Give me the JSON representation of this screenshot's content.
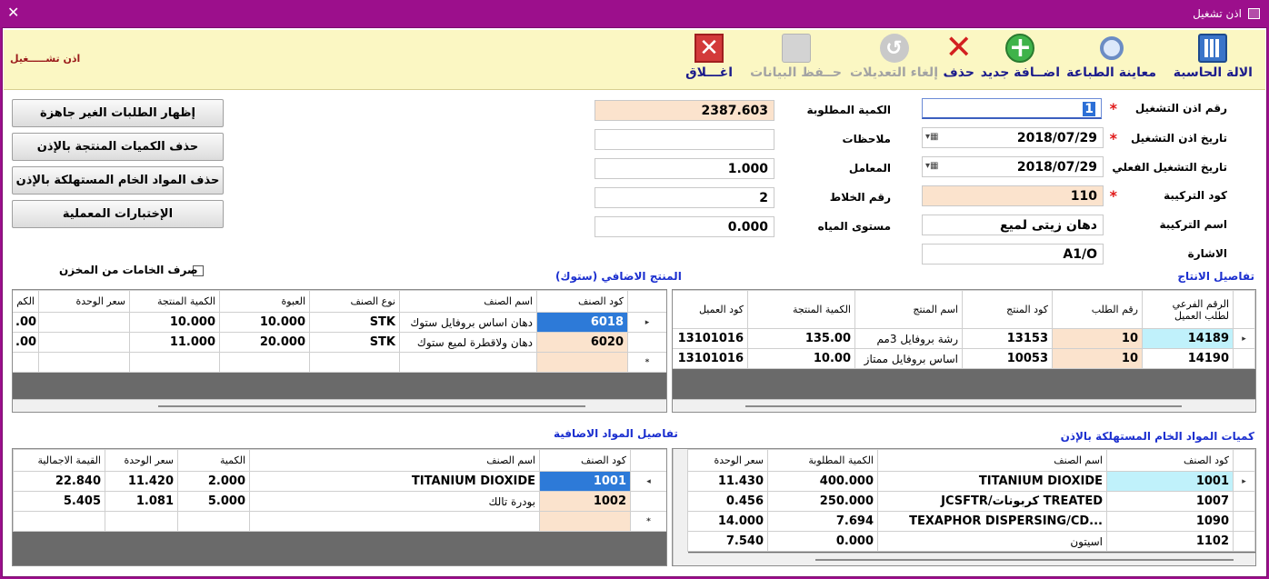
{
  "window": {
    "title": "اذن تشغيل"
  },
  "side_title": "اذن تشـــــغيل",
  "toolbar": {
    "calculator": "الالة الحاسبة",
    "print_preview": "معاينة الطباعة",
    "add_new": "اضــافة جديد",
    "delete": "حذف",
    "undo": "إلغاء التعديلات",
    "save": "حــفظ البيانات",
    "close": "اغـــلاق"
  },
  "form": {
    "order_no_label": "رقم اذن التشغيل",
    "order_no": "1",
    "order_date_label": "تاريخ اذن التشغيل",
    "order_date": "2018/07/29",
    "actual_date_label": "تاريخ التشغيل الفعلي",
    "actual_date": "2018/07/29",
    "formula_code_label": "كود التركيبة",
    "formula_code": "110",
    "formula_name_label": "اسم التركيبة",
    "formula_name": "دهان زيتى لميع",
    "reference_label": "الاشارة",
    "reference": "A1/O",
    "required_qty_label": "الكمية المطلوبة",
    "required_qty": "2387.603",
    "notes_label": "ملاحظات",
    "notes": "",
    "factor_label": "المعامل",
    "factor": "1.000",
    "mixer_no_label": "رقم الخلاط",
    "mixer_no": "2",
    "water_level_label": "مستوى المياه",
    "water_level": "0.000"
  },
  "buttons": {
    "show_not_ready": "إظهار الطلبات الغير جاهزة",
    "delete_produced": "حذف الكميات المنتجة بالإذن",
    "delete_consumed": "حذف المواد الخام المستهلكة بالإذن",
    "lab_tests": "الإختبارات المعملية"
  },
  "checkbox": {
    "label": "صرف الخامات من المخزن",
    "checked": false
  },
  "production_details": {
    "title": "تفاصيل الانتاج",
    "headers": [
      "الرقم الفرعي لطلب العميل",
      "رقم الطلب",
      "كود المنتج",
      "اسم المنتج",
      "الكمية المنتجة",
      "كود العميل"
    ],
    "rows": [
      [
        "14189",
        "10",
        "13153",
        "رشة بروفايل 3مم",
        "135.00",
        "13101016"
      ],
      [
        "14190",
        "10",
        "10053",
        "اساس بروفايل ممتاز",
        "10.00",
        "13101016"
      ]
    ]
  },
  "additional_product": {
    "title": "المنتج الاضافي (ستوك)",
    "headers": [
      "كود الصنف",
      "اسم الصنف",
      "نوع الصنف",
      "العبوة",
      "الكمية المنتجة",
      "سعر الوحدة",
      "الكم"
    ],
    "rows": [
      [
        "6018",
        "دهان اساس بروفايل ستوك",
        "STK",
        "10.000",
        "10.000",
        "",
        ".00"
      ],
      [
        "6020",
        "دهان ولاقطرة لميع ستوك",
        "STK",
        "20.000",
        "11.000",
        "",
        ".00"
      ]
    ]
  },
  "raw_materials": {
    "title": "كميات المواد الخام المستهلكة بالإذن",
    "headers": [
      "كود الصنف",
      "اسم الصنف",
      "الكمية المطلوبة",
      "سعر الوحدة"
    ],
    "rows": [
      [
        "1001",
        "TITANIUM DIOXIDE",
        "400.000",
        "11.430"
      ],
      [
        "1007",
        "JCSFTR/كربونات TREATED",
        "250.000",
        "0.456"
      ],
      [
        "1090",
        "TEXAPHOR DISPERSING/CD...",
        "7.694",
        "14.000"
      ],
      [
        "1102",
        "اسيتون",
        "0.000",
        "7.540"
      ]
    ]
  },
  "additional_materials": {
    "title": "تفاصيل المواد الاضافية",
    "headers": [
      "كود الصنف",
      "اسم الصنف",
      "الكمية",
      "سعر الوحدة",
      "القيمة الاجمالية"
    ],
    "rows": [
      [
        "1001",
        "TITANIUM DIOXIDE",
        "2.000",
        "11.420",
        "22.840"
      ],
      [
        "1002",
        "بودرة تالك",
        "5.000",
        "1.081",
        "5.405"
      ]
    ]
  }
}
